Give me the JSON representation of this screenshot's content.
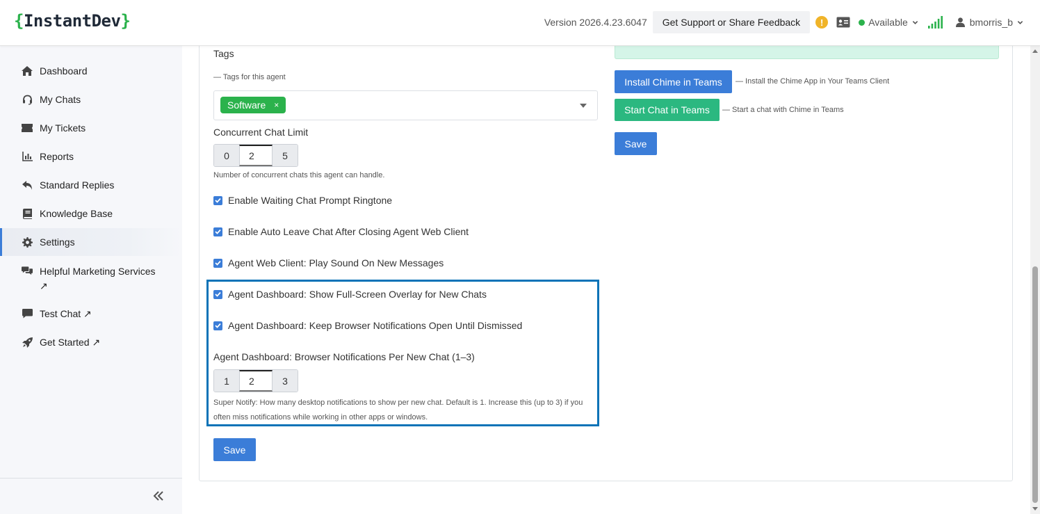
{
  "header": {
    "logo_open": "{",
    "logo_text": "InstantDev",
    "logo_close": "}",
    "version": "Version 2026.4.23.6047",
    "support_label": "Get Support or Share Feedback",
    "alert_glyph": "!",
    "status": "Available",
    "username": "bmorris_b"
  },
  "sidebar": {
    "items": [
      {
        "label": "Dashboard",
        "icon": "home-icon"
      },
      {
        "label": "My Chats",
        "icon": "headset-icon"
      },
      {
        "label": "My Tickets",
        "icon": "ticket-icon"
      },
      {
        "label": "Reports",
        "icon": "chart-icon"
      },
      {
        "label": "Standard Replies",
        "icon": "reply-icon"
      },
      {
        "label": "Knowledge Base",
        "icon": "book-icon"
      },
      {
        "label": "Settings",
        "icon": "gear-icon",
        "active": true
      },
      {
        "label": "Helpful Marketing Services ↗",
        "icon": "comments-icon"
      },
      {
        "label": "Test Chat ↗",
        "icon": "chat-icon"
      },
      {
        "label": "Get Started ↗",
        "icon": "rocket-icon"
      }
    ]
  },
  "form": {
    "tags_label": "Tags",
    "tags_hint": "— Tags for this agent",
    "tag_value": "Software",
    "tag_remove": "×",
    "concurrent_label": "Concurrent Chat Limit",
    "concurrent_min": "0",
    "concurrent_value": "2",
    "concurrent_max": "5",
    "concurrent_hint": "Number of concurrent chats this agent can handle.",
    "checkboxes": [
      {
        "label": "Enable Waiting Chat Prompt Ringtone",
        "checked": true
      },
      {
        "label": "Enable Auto Leave Chat After Closing Agent Web Client",
        "checked": true
      },
      {
        "label": "Agent Web Client: Play Sound On New Messages",
        "checked": true
      },
      {
        "label": "Agent Dashboard: Show Full-Screen Overlay for New Chats",
        "checked": true
      },
      {
        "label": "Agent Dashboard: Keep Browser Notifications Open Until Dismissed",
        "checked": true
      }
    ],
    "notify_label": "Agent Dashboard: Browser Notifications Per New Chat (1–3)",
    "notify_min": "1",
    "notify_value": "2",
    "notify_max": "3",
    "notify_hint_1": "Super Notify: How many desktop notifications to show per new chat. Default is 1. Increase this (up to 3) if you",
    "notify_hint_2": "often miss notifications while working in other apps or windows.",
    "save_label": "Save"
  },
  "teams": {
    "install_label": "Install Chime in Teams",
    "install_hint": "— Install the Chime App in Your Teams Client",
    "start_label": "Start Chat in Teams",
    "start_hint": "— Start a chat with Chime in Teams",
    "save_label": "Save"
  },
  "colors": {
    "accent_blue": "#3b7dd8",
    "brand_green": "#2bb24c",
    "teams_green": "#2bb880",
    "highlight_border": "#0a73b7"
  }
}
